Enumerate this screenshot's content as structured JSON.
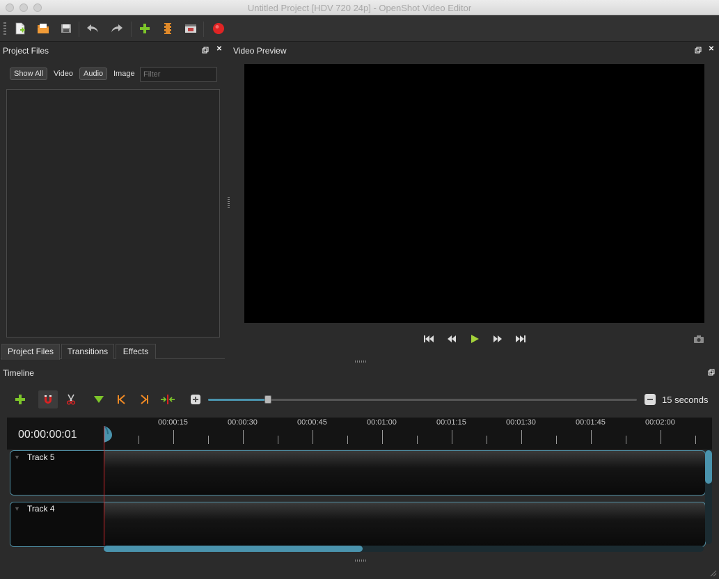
{
  "window": {
    "title": "Untitled Project [HDV 720 24p] - OpenShot Video Editor"
  },
  "toolbar": {
    "items": [
      {
        "name": "new-project-icon",
        "color": "#8fce4a"
      },
      {
        "name": "open-project-icon",
        "color": "#e08a2a"
      },
      {
        "name": "save-project-icon",
        "color": "#b8b8b8"
      },
      {
        "name": "undo-icon",
        "color": "#c8c8c8"
      },
      {
        "name": "redo-icon",
        "color": "#c8c8c8"
      },
      {
        "name": "import-files-icon",
        "color": "#7dc52a"
      },
      {
        "name": "choose-profile-icon",
        "color": "#e08a2a"
      },
      {
        "name": "fullscreen-icon",
        "color": "#d0d0d0"
      },
      {
        "name": "export-video-icon",
        "color": "#e02424"
      }
    ]
  },
  "project_files": {
    "title": "Project Files",
    "filters": {
      "show_all": "Show All",
      "video": "Video",
      "audio": "Audio",
      "image": "Image"
    },
    "filter_placeholder": "Filter",
    "tabs": [
      "Project Files",
      "Transitions",
      "Effects"
    ]
  },
  "video_preview": {
    "title": "Video Preview"
  },
  "timeline": {
    "title": "Timeline",
    "zoom_label": "15 seconds",
    "zoom_fraction": 0.14,
    "current_time": "00:00:00:01",
    "ruler_labels": [
      "00:00:15",
      "00:00:30",
      "00:00:45",
      "00:01:00",
      "00:01:15",
      "00:01:30",
      "00:01:45",
      "00:02:00"
    ],
    "tracks": [
      "Track 5",
      "Track 4"
    ]
  },
  "colors": {
    "accent": "#4a93ad",
    "playhead": "#d0262a"
  }
}
